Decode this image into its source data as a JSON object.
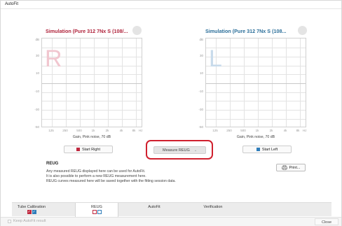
{
  "window": {
    "title": "AutoFit"
  },
  "right_panel": {
    "title": "Simulation (Pure 312 7Nx S (108/...",
    "letter": "R",
    "y_ticks": [
      "dB",
      "30",
      "10",
      "-10",
      "-30",
      "-50"
    ],
    "x_ticks": [
      "125",
      "250",
      "500",
      "1k",
      "2k",
      "4k",
      "8k"
    ],
    "x_unit": "Hz",
    "gain_label": "Gain, Pink noise, 70 dB",
    "start_button": "Start Right"
  },
  "left_panel": {
    "title": "Simulation (Pure 312 7Nx S (108...",
    "letter": "L",
    "y_ticks": [
      "dB",
      "30",
      "10",
      "-10",
      "-30",
      "-50"
    ],
    "x_ticks": [
      "125",
      "250",
      "500",
      "1k",
      "2k",
      "4k",
      "8k"
    ],
    "x_unit": "Hz",
    "gain_label": "Gain, Pink noise, 70 dB",
    "start_button": "Start Left"
  },
  "measure": {
    "label": "Measure REUG"
  },
  "reug": {
    "heading": "REUG",
    "lines": [
      "Any measured REUG displayed here can be used for AutoFit.",
      "It is also possible to perform a new REUG measurement here.",
      "REUG curves measured here will be saved together with the fitting session data."
    ]
  },
  "print_button": "Print...",
  "tabs": [
    {
      "label": "Tube Calibration"
    },
    {
      "label": "REUG"
    },
    {
      "label": "AutoFit"
    },
    {
      "label": "Verification"
    }
  ],
  "footer": {
    "keep_label": "Keep AutoFit result",
    "close_label": "Close"
  },
  "colors": {
    "right": "#c0283f",
    "left": "#2f7dba",
    "highlight": "#d0202e"
  }
}
